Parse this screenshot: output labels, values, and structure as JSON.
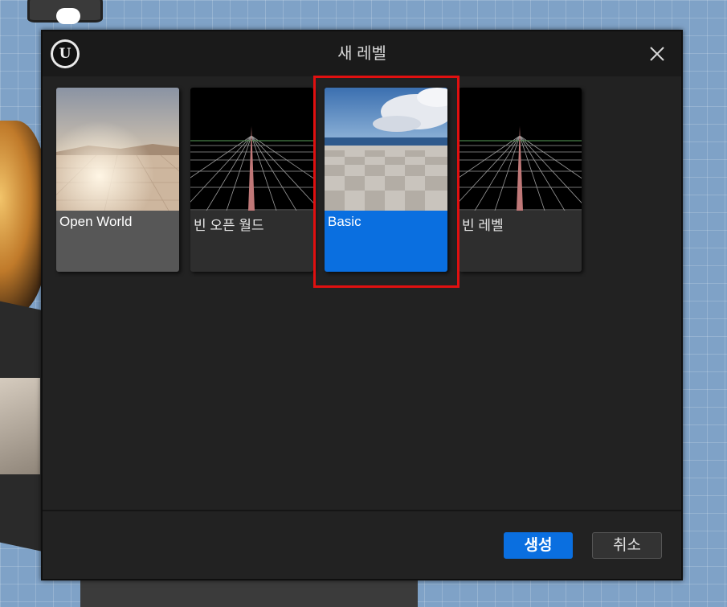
{
  "dialog": {
    "title": "새 레벨",
    "close_icon": "close-icon",
    "logo_icon": "unreal-engine-logo",
    "logo_letter": "U"
  },
  "templates": [
    {
      "label": "Open World",
      "thumbnail": "open-world-thumbnail",
      "selected": false
    },
    {
      "label": "빈 오픈 월드",
      "thumbnail": "empty-grid-thumbnail",
      "selected": false
    },
    {
      "label": "Basic",
      "thumbnail": "basic-sky-floor-thumbnail",
      "selected": true
    },
    {
      "label": "빈 레벨",
      "thumbnail": "empty-grid-thumbnail",
      "selected": false
    }
  ],
  "footer": {
    "create_label": "생성",
    "cancel_label": "취소"
  },
  "colors": {
    "accent": "#0a6fe0",
    "highlight": "#e01010",
    "dialog_bg": "#222222"
  }
}
